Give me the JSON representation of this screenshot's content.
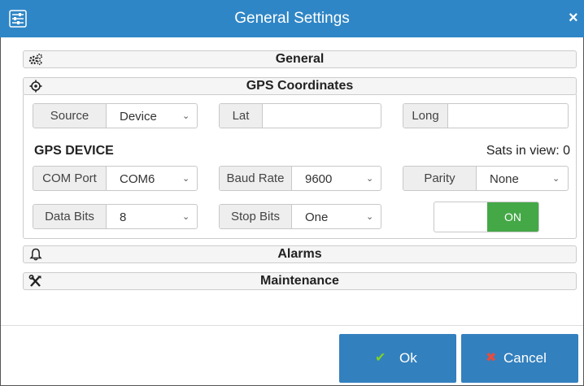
{
  "window": {
    "title": "General Settings",
    "close": "×"
  },
  "sections": {
    "general": "General",
    "gps": "GPS Coordinates",
    "alarms": "Alarms",
    "maintenance": "Maintenance"
  },
  "coords": {
    "source_label": "Source",
    "source_value": "Device",
    "lat_label": "Lat",
    "lat_value": "",
    "long_label": "Long",
    "long_value": ""
  },
  "device": {
    "heading": "GPS DEVICE",
    "sats_label": "Sats in view: 0",
    "com_label": "COM Port",
    "com_value": "COM6",
    "baud_label": "Baud Rate",
    "baud_value": "9600",
    "parity_label": "Parity",
    "parity_value": "None",
    "databits_label": "Data Bits",
    "databits_value": "8",
    "stopbits_label": "Stop Bits",
    "stopbits_value": "One",
    "toggle_label": "ON"
  },
  "buttons": {
    "ok": "Ok",
    "cancel": "Cancel"
  },
  "icons": {
    "title": "sliders-icon",
    "close": "close-icon",
    "general": "gears-icon",
    "gps": "crosshairs-icon",
    "alarms": "bell-icon",
    "maintenance": "tools-icon",
    "ok": "check-icon",
    "cancel": "times-icon",
    "select": "chevron-down-icon"
  },
  "colors": {
    "titlebar": "#2f86c6",
    "button": "#3380be",
    "toggle_on": "#45a847",
    "cancel_icon": "#e74c3c",
    "ok_icon": "#7ed321"
  }
}
